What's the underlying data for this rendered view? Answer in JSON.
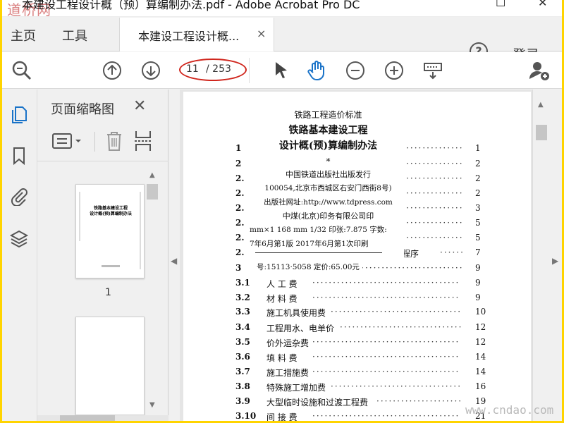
{
  "window": {
    "title": "本建设工程设计概（预）算编制办法.pdf - Adobe Acrobat Pro DC",
    "watermark_top": "道桥网",
    "watermark_bottom": "www.cndao.com"
  },
  "menu": {
    "home": "主页",
    "tools": "工具",
    "tab_title": "本建设工程设计概...",
    "tab_close": "×",
    "help": "?",
    "login": "登录"
  },
  "toolbar": {
    "current_page": "11",
    "total_pages": "/ 253",
    "icons": [
      "search-icon",
      "page-up-icon",
      "page-down-icon",
      "select-arrow-icon",
      "hand-icon",
      "zoom-out-icon",
      "zoom-in-icon",
      "scroll-mode-icon",
      "share-user-icon"
    ],
    "accent": "#1a73c8",
    "highlight_ring": "#d0261d"
  },
  "sidebar": {
    "title": "页面缩略图",
    "close": "✕",
    "thumb_label": "1",
    "rail_icons": [
      "pages-icon",
      "bookmark-icon",
      "attachment-icon",
      "layers-icon"
    ]
  },
  "thumbnail": {
    "line1": "铁路基本建设工程",
    "line2": "设计概(预)算编制办法"
  },
  "doc": {
    "publisher": {
      "l1": "铁路工程造价标准",
      "l2": "铁路基本建设工程",
      "l3": "设计概(预)算编制办法",
      "l4": "*",
      "l5": "中国铁道出版社出版发行",
      "l6": "100054,北京市西城区右安门西街8号)",
      "l7": "出版社网址:http://www.tdpress.com",
      "l8": "中煤(北京)印务有限公司印",
      "l9": "mm×1 168 mm  1/32  印张:7.875  字数:",
      "l10": "7年6月第1版  2017年6月第1次印刷",
      "l11": "号:15113·5058      定价:65.00元"
    },
    "toc": [
      {
        "n": "1",
        "label": "",
        "page": "1"
      },
      {
        "n": "2",
        "label": "",
        "page": "2"
      },
      {
        "n": "2.",
        "label": "",
        "page": "2"
      },
      {
        "n": "2.",
        "label": "",
        "page": "2"
      },
      {
        "n": "2.",
        "label": "",
        "page": "3"
      },
      {
        "n": "2.",
        "label": "",
        "page": "5"
      },
      {
        "n": "2.",
        "label": "",
        "page": "5"
      },
      {
        "n": "2.",
        "label": "程序",
        "page": "7"
      },
      {
        "n": "3",
        "label": "",
        "page": "9"
      },
      {
        "n": "3.1",
        "label": "人 工 费",
        "page": "9"
      },
      {
        "n": "3.2",
        "label": "材 料 费",
        "page": "9"
      },
      {
        "n": "3.3",
        "label": "施工机具使用费",
        "page": "10"
      },
      {
        "n": "3.4",
        "label": "工程用水、电单价",
        "page": "12"
      },
      {
        "n": "3.5",
        "label": "价外运杂费",
        "page": "12"
      },
      {
        "n": "3.6",
        "label": "填 料 费",
        "page": "14"
      },
      {
        "n": "3.7",
        "label": "施工措施费",
        "page": "14"
      },
      {
        "n": "3.8",
        "label": "特殊施工增加费",
        "page": "16"
      },
      {
        "n": "3.9",
        "label": "大型临时设施和过渡工程费",
        "page": "19"
      },
      {
        "n": "3.10",
        "label": "间 接 费",
        "page": "21"
      }
    ]
  }
}
